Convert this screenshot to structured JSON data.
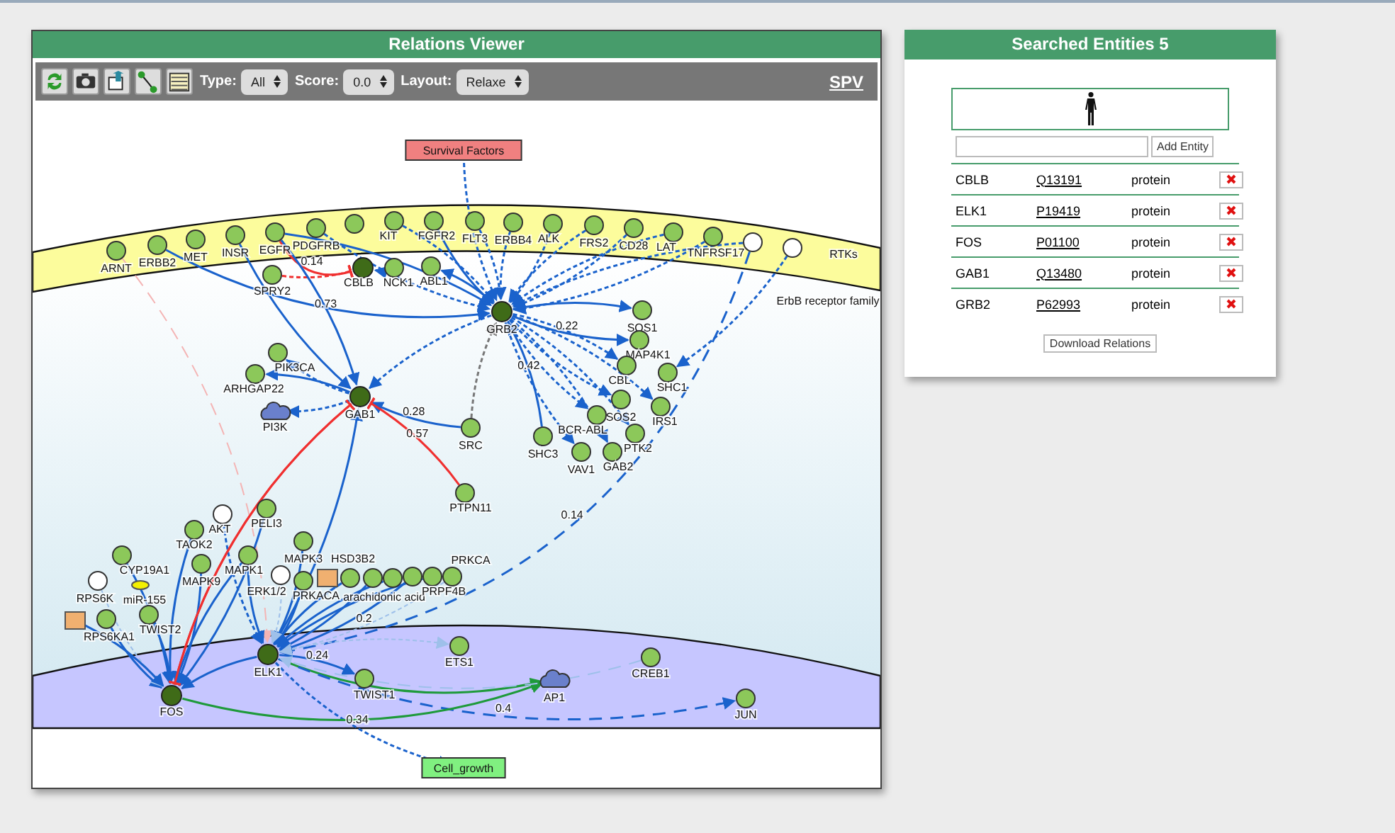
{
  "viewer": {
    "title": "Relations Viewer",
    "filters": [
      {
        "label": "Type:",
        "value": "All"
      },
      {
        "label": "Score:",
        "value": "0.0"
      },
      {
        "label": "Layout:",
        "value": "Relaxe"
      }
    ],
    "link": "SPV",
    "graph": {
      "nodes": [
        {
          "kind": "protein",
          "label": "ARNT"
        },
        {
          "kind": "protein",
          "label": "ERBB2"
        },
        {
          "kind": "protein",
          "label": "MET"
        },
        {
          "kind": "protein",
          "label": "INSR"
        },
        {
          "kind": "protein",
          "label": "EGFR"
        },
        {
          "kind": "protein",
          "label": "PDGFRB"
        },
        {
          "kind": "protein"
        },
        {
          "kind": "protein",
          "label": "KIT"
        },
        {
          "kind": "protein",
          "label": "FGFR2"
        },
        {
          "kind": "protein",
          "label": "FLT3"
        },
        {
          "kind": "protein",
          "label": "ERBB4"
        },
        {
          "kind": "protein",
          "label": "ALK"
        },
        {
          "kind": "protein",
          "label": "FRS2"
        },
        {
          "kind": "protein",
          "label": "CD28"
        },
        {
          "kind": "protein",
          "label": "LAT"
        },
        {
          "kind": "protein",
          "label": "TNFRSF17"
        },
        {
          "kind": "family",
          "label": "ErbB receptor family"
        },
        {
          "kind": "family",
          "label": "RTKs"
        },
        {
          "kind": "query",
          "label": "CBLB"
        },
        {
          "kind": "protein",
          "label": "NCK1"
        },
        {
          "kind": "protein",
          "label": "ABL1"
        },
        {
          "kind": "protein",
          "label": "SPRY2"
        },
        {
          "kind": "query",
          "label": "GRB2"
        },
        {
          "kind": "protein",
          "label": "SOS1"
        },
        {
          "kind": "protein",
          "label": "MAP4K1"
        },
        {
          "kind": "protein",
          "label": "CBL"
        },
        {
          "kind": "protein",
          "label": "SHC1"
        },
        {
          "kind": "protein",
          "label": "SOS2"
        },
        {
          "kind": "protein",
          "label": "IRS1"
        },
        {
          "kind": "protein",
          "label": "BCR-ABL"
        },
        {
          "kind": "protein",
          "label": "PTK2"
        },
        {
          "kind": "protein",
          "label": "VAV1"
        },
        {
          "kind": "protein",
          "label": "GAB2"
        },
        {
          "kind": "protein",
          "label": "SHC3"
        },
        {
          "kind": "protein",
          "label": "SRC"
        },
        {
          "kind": "protein",
          "label": "PTPN11"
        },
        {
          "kind": "query",
          "label": "GAB1"
        },
        {
          "kind": "protein",
          "label": "PIK3CA"
        },
        {
          "kind": "protein",
          "label": "ARHGAP22"
        },
        {
          "kind": "complex",
          "label": "PI3K"
        },
        {
          "kind": "protein",
          "label": "PELI3"
        },
        {
          "kind": "family",
          "label": "AKT"
        },
        {
          "kind": "protein",
          "label": "TAOK2"
        },
        {
          "kind": "protein",
          "label": "MAPK3"
        },
        {
          "kind": "protein",
          "label": "MAPK9"
        },
        {
          "kind": "protein",
          "label": "MAPK1"
        },
        {
          "kind": "family",
          "label": "ERK1/2"
        },
        {
          "kind": "protein",
          "label": "PRKACA"
        },
        {
          "kind": "protein",
          "label": "HSD3B2"
        },
        {
          "kind": "chemical",
          "label": "arachidonic acid"
        },
        {
          "kind": "protein"
        },
        {
          "kind": "protein"
        },
        {
          "kind": "protein"
        },
        {
          "kind": "protein",
          "label": "PRPF4B"
        },
        {
          "kind": "protein",
          "label": "PRKCA"
        },
        {
          "kind": "protein",
          "label": "CYP19A1"
        },
        {
          "kind": "family",
          "label": "RPS6K"
        },
        {
          "kind": "mirna",
          "label": "miR-155"
        },
        {
          "kind": "chemical"
        },
        {
          "kind": "protein",
          "label": "RPS6KA1"
        },
        {
          "kind": "protein",
          "label": "TWIST2"
        },
        {
          "kind": "query",
          "label": "FOS"
        },
        {
          "kind": "query",
          "label": "ELK1"
        },
        {
          "kind": "protein",
          "label": "TWIST1"
        },
        {
          "kind": "protein",
          "label": "ETS1"
        },
        {
          "kind": "complex",
          "label": "AP1"
        },
        {
          "kind": "protein",
          "label": "CREB1"
        },
        {
          "kind": "protein",
          "label": "JUN"
        },
        {
          "kind": "phenotype",
          "label": "Survival Factors",
          "color": "#f08080"
        },
        {
          "kind": "phenotype",
          "label": "Cell_growth",
          "color": "#80f080"
        }
      ],
      "edges": [
        {
          "kind": "activation"
        },
        {
          "kind": "predicted"
        },
        {
          "kind": "predicted"
        },
        {
          "kind": "activation"
        },
        {
          "kind": "predicted"
        },
        {
          "kind": "predicted"
        },
        {
          "kind": "predicted"
        },
        {
          "kind": "predicted"
        },
        {
          "kind": "predicted"
        },
        {
          "kind": "predicted"
        },
        {
          "kind": "predicted"
        },
        {
          "kind": "predicted"
        },
        {
          "kind": "predicted"
        },
        {
          "kind": "activation"
        },
        {
          "kind": "activation"
        },
        {
          "kind": "activation"
        },
        {
          "kind": "predicted",
          "weight": "0.22"
        },
        {
          "kind": "predicted"
        },
        {
          "kind": "predicted"
        },
        {
          "kind": "predicted"
        },
        {
          "kind": "predicted"
        },
        {
          "kind": "predicted"
        },
        {
          "kind": "predicted"
        },
        {
          "kind": "activation",
          "weight": "0.42"
        },
        {
          "kind": "binding"
        },
        {
          "kind": "predicted"
        },
        {
          "kind": "inhibition",
          "weight": "0.14"
        },
        {
          "kind": "putative"
        },
        {
          "kind": "activation"
        },
        {
          "kind": "activation"
        },
        {
          "kind": "activation",
          "weight": "0.73"
        },
        {
          "kind": "activation"
        },
        {
          "kind": "activation",
          "weight": "0.28"
        },
        {
          "kind": "inhibition",
          "weight": "0.57"
        },
        {
          "kind": "predicted"
        },
        {
          "kind": "activation"
        },
        {
          "kind": "predicted"
        },
        {
          "kind": "activation"
        },
        {
          "kind": "inhibition"
        },
        {
          "kind": "predicted"
        },
        {
          "kind": "predicted",
          "weight": "0.34"
        },
        {
          "kind": "predicted",
          "weight": "0.14"
        },
        {
          "kind": "correlation"
        },
        {
          "kind": "activation"
        },
        {
          "kind": "activation"
        },
        {
          "kind": "activation"
        },
        {
          "kind": "activation"
        },
        {
          "kind": "predicted"
        },
        {
          "kind": "activation"
        },
        {
          "kind": "activation"
        },
        {
          "kind": "activation"
        },
        {
          "kind": "activation"
        },
        {
          "kind": "activation"
        },
        {
          "kind": "activation"
        },
        {
          "kind": "activation"
        },
        {
          "kind": "activation"
        },
        {
          "kind": "indirect"
        },
        {
          "kind": "activation"
        },
        {
          "kind": "activation",
          "weight": "0.24"
        },
        {
          "kind": "expression"
        },
        {
          "kind": "indirect"
        },
        {
          "kind": "predicted",
          "weight": "0.4"
        },
        {
          "kind": "indirect",
          "weight": "0.2"
        },
        {
          "kind": "expression"
        },
        {
          "kind": "activation"
        },
        {
          "kind": "activation"
        },
        {
          "kind": "activation"
        },
        {
          "kind": "indirect"
        },
        {
          "kind": "activation"
        },
        {
          "kind": "inhibition"
        },
        {
          "kind": "indirect"
        }
      ]
    }
  },
  "entities": {
    "title": "Searched Entities 5",
    "add_button": "Add Entity",
    "rows": [
      {
        "name": "CBLB",
        "id": "Q13191",
        "type": "protein"
      },
      {
        "name": "ELK1",
        "id": "P19419",
        "type": "protein"
      },
      {
        "name": "FOS",
        "id": "P01100",
        "type": "protein"
      },
      {
        "name": "GAB1",
        "id": "Q13480",
        "type": "protein"
      },
      {
        "name": "GRB2",
        "id": "P62993",
        "type": "protein"
      }
    ],
    "download_button": "Download Relations"
  }
}
